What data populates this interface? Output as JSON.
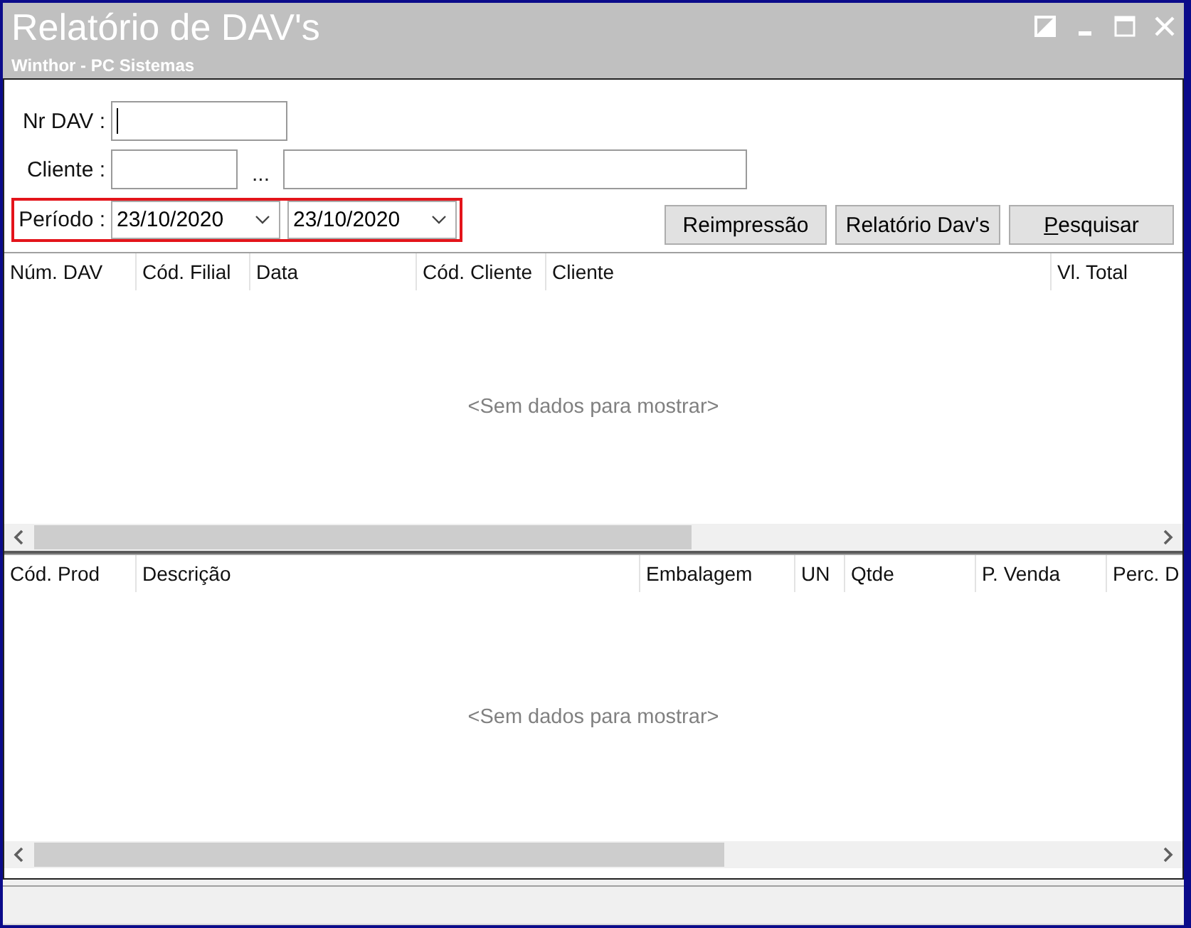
{
  "window": {
    "title": "Relatório de DAV's",
    "subtitle": "Winthor - PC Sistemas"
  },
  "filters": {
    "nr_dav": {
      "label": "Nr DAV :",
      "focused": true
    },
    "cliente": {
      "label": "Cliente :",
      "lookup": "..."
    },
    "periodo": {
      "label": "Período :",
      "from": "23/10/2020",
      "to": "23/10/2020",
      "highlighted": true
    }
  },
  "buttons": [
    {
      "label": "Reimpressão",
      "mnemonic": false
    },
    {
      "label": "Relatório Dav's",
      "mnemonic": false
    },
    {
      "label": "Pesquisar",
      "mnemonic": true
    }
  ],
  "grids": [
    {
      "columns": [
        "Núm. DAV",
        "Cód. Filial",
        "Data",
        "Cód. Cliente",
        "Cliente",
        "Vl. Total"
      ],
      "empty_text": "<Sem dados para mostrar>"
    },
    {
      "columns": [
        "Cód. Prod",
        "Descrição",
        "Embalagem",
        "UN",
        "Qtde",
        "P. Venda",
        "Perc. D"
      ],
      "empty_text": "<Sem dados para mostrar>"
    }
  ]
}
